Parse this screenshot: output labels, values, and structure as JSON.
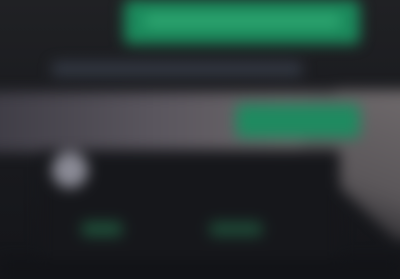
{
  "colors": {
    "background": "#1c1d21",
    "accent_green": "#1b8a5c",
    "panel_light": "#5a565e",
    "avatar_gray": "#8a8a95"
  },
  "top_button": {
    "label": "",
    "icon": ""
  },
  "info_line": {
    "text": ""
  },
  "side_button": {
    "label": ""
  },
  "avatar": {
    "icon": "user-avatar-icon"
  },
  "content": {
    "item_1": "",
    "item_2": ""
  }
}
